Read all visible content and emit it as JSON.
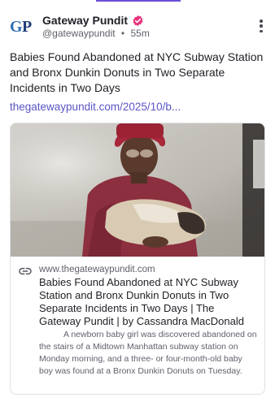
{
  "post": {
    "author_name": "Gateway Pundit",
    "handle": "@gatewaypundit",
    "separator": "•",
    "time_ago": "55m",
    "avatar_letters": "GP",
    "text": "Babies Found Abandoned at NYC Subway Station and Bronx Dunkin Donuts in Two Separate Incidents in Two Days",
    "link_text": "thegatewaypundit.com/2025/10/b..."
  },
  "card": {
    "domain": "www.thegatewaypundit.com",
    "title": "Babies Found Abandoned at NYC Subway Station and Bronx Dunkin Donuts in Two Separate Incidents in Two Days | The Gateway Pundit | by Cassandra MacDonald",
    "description": "A newborn baby girl was discovered abandoned on the stairs of a Midtown Manhattan subway station on Monday morning, and a three- or four-month-old baby boy was found at a Bronx Dunkin Donuts on Tuesday."
  },
  "icons": {
    "verified": "verified-badge-icon",
    "more": "more-vertical-icon",
    "link": "link-icon"
  },
  "colors": {
    "accent": "#6d4fd8",
    "link": "#5a55c7",
    "verified": "#e8327d",
    "logo_blue": "#2f6fb3"
  }
}
